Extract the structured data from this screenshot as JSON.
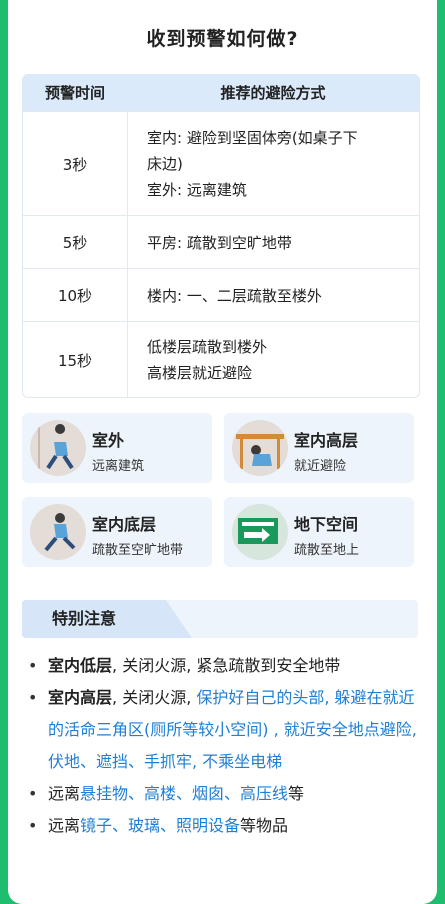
{
  "title": "收到预警如何做?",
  "table": {
    "headers": [
      "预警时间",
      "推荐的避险方式"
    ],
    "rows": [
      {
        "time": "3秒",
        "lines": [
          "室内: 避险到坚固体旁(如桌子下",
          "床边)",
          "室外: 远离建筑"
        ]
      },
      {
        "time": "5秒",
        "lines": [
          "平房: 疏散到空旷地带"
        ]
      },
      {
        "time": "10秒",
        "lines": [
          "楼内: 一、二层疏散至楼外"
        ]
      },
      {
        "time": "15秒",
        "lines": [
          "低楼层疏散到楼外",
          "高楼层就近避险"
        ]
      }
    ]
  },
  "tiles": [
    {
      "title": "室外",
      "sub": "远离建筑",
      "icon": "outdoor-running-person-icon"
    },
    {
      "title": "室内高层",
      "sub": "就近避险",
      "icon": "crouching-under-table-icon"
    },
    {
      "title": "室内底层",
      "sub": "疏散至空旷地带",
      "icon": "evacuating-person-icon"
    },
    {
      "title": "地下空间",
      "sub": "疏散至地上",
      "icon": "emergency-exit-sign-icon"
    }
  ],
  "note": {
    "label": "特别注意",
    "b1": {
      "bold": "室内低层",
      "rest": ", 关闭火源, 紧急疏散到安全地带"
    },
    "b2": {
      "bold": "室内高层",
      "pre": ", 关闭火源, ",
      "hl": "保护好自己的头部, 躲避在就近的活命三角区(厕所等较小空间) , 就近安全地点避险, 伏地、遮挡、手抓牢, 不乘坐电梯"
    },
    "b3": {
      "pre": "远离",
      "hl": "悬挂物、高楼、烟囱、高压线",
      "post": "等"
    },
    "b4": {
      "pre": "远离",
      "hl": "镜子、玻璃、照明设备",
      "post": "等物品"
    }
  },
  "colors": {
    "frame": "#1fbe6e",
    "header": "#dbeafa",
    "tile": "#eef4fb",
    "highlight": "#1e7fd6"
  }
}
